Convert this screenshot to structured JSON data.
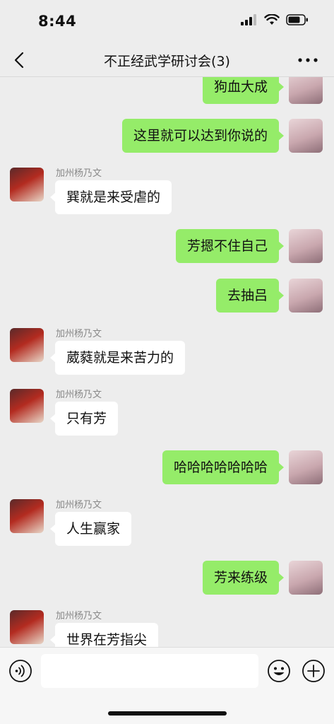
{
  "status_bar": {
    "time": "8:44"
  },
  "header": {
    "title": "不正经武学研讨会(3)"
  },
  "messages": [
    {
      "side": "mine",
      "text": "狗血大成"
    },
    {
      "side": "mine",
      "text": "这里就可以达到你说的"
    },
    {
      "side": "other",
      "sender": "加州杨乃文",
      "text": "巽就是来受虐的"
    },
    {
      "side": "mine",
      "text": "芳摁不住自己"
    },
    {
      "side": "mine",
      "text": "去抽吕"
    },
    {
      "side": "other",
      "sender": "加州杨乃文",
      "text": "葳蕤就是来苦力的"
    },
    {
      "side": "other",
      "sender": "加州杨乃文",
      "text": "只有芳"
    },
    {
      "side": "mine",
      "text": "哈哈哈哈哈哈哈"
    },
    {
      "side": "other",
      "sender": "加州杨乃文",
      "text": "人生赢家"
    },
    {
      "side": "mine",
      "text": "芳来练级"
    },
    {
      "side": "other",
      "sender": "加州杨乃文",
      "text": "世界在芳指尖"
    }
  ],
  "icons": {
    "back": "chevron-left-icon",
    "more": "more-dots-icon",
    "voice": "voice-icon",
    "emoji": "emoji-icon",
    "plus": "plus-icon"
  },
  "colors": {
    "my_bubble": "#95ec69",
    "other_bubble": "#ffffff",
    "background": "#ededed"
  }
}
